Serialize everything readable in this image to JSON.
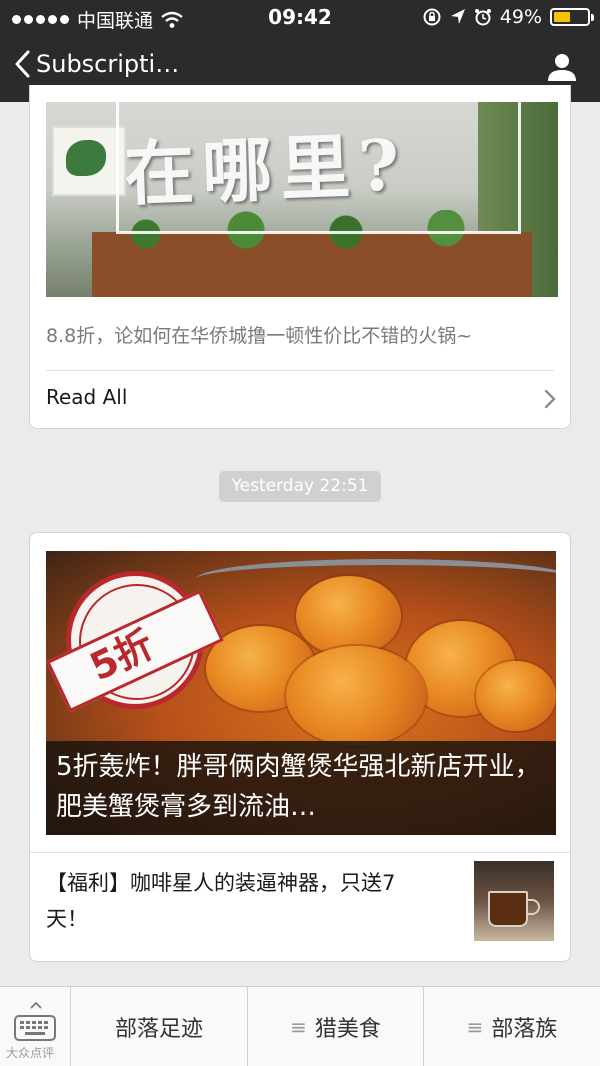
{
  "status_bar": {
    "carrier": "中国联通",
    "time": "09:42",
    "battery": "49%",
    "battery_level": 0.49
  },
  "nav": {
    "back_label": "Subscripti…"
  },
  "card1": {
    "image_headline": "在哪里?",
    "snippet": "8.8折，论如何在华侨城撸一顿性价比不错的火锅~",
    "read_all": "Read All"
  },
  "timestamp": "Yesterday 22:51",
  "card2": {
    "stamp_text": "5折",
    "main_title": "5折轰炸！胖哥俩肉蟹煲华强北新店开业，肥美蟹煲膏多到流油…",
    "secondary_title": "【福利】咖啡星人的装逼神器，只送7天！"
  },
  "menu": {
    "items": [
      {
        "label": "部落足迹",
        "icon": ""
      },
      {
        "label": "猎美食",
        "icon": "≡"
      },
      {
        "label": "部落族",
        "icon": "≡"
      }
    ]
  },
  "watermark": "大众点评"
}
